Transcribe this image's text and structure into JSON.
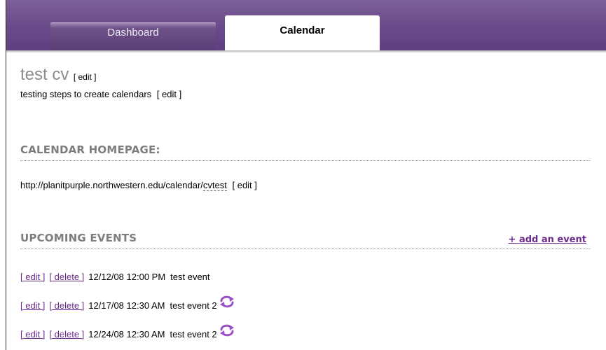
{
  "tabs": {
    "dashboard": "Dashboard",
    "calendar": "Calendar"
  },
  "calendar": {
    "title": "test cv",
    "title_edit": "[ edit ]",
    "description": "testing steps to create calendars",
    "description_edit": "[ edit ]"
  },
  "homepage": {
    "heading": "CALENDAR HOMEPAGE:",
    "url_base": "http://planitpurple.northwestern.edu/calendar/",
    "url_slug": "cvtest",
    "edit": "[ edit ]"
  },
  "events": {
    "heading": "UPCOMING EVENTS",
    "add_label": "+ add an event",
    "edit_label": "[ edit ]",
    "delete_label": "[ delete ]",
    "items": [
      {
        "datetime": "12/12/08 12:00 PM",
        "name": "test event",
        "recurring": false
      },
      {
        "datetime": "12/17/08 12:30 AM",
        "name": "test event 2",
        "recurring": true
      },
      {
        "datetime": "12/24/08 12:30 AM",
        "name": "test event 2",
        "recurring": true
      }
    ]
  },
  "colors": {
    "tabbar": "#6a4a8a",
    "link": "#6b2c8c",
    "heading": "#7d7d7d",
    "title": "#8c8c8c",
    "repeat_icon": "#9b4fc9"
  },
  "icons": {
    "recurring": "repeat-icon"
  }
}
